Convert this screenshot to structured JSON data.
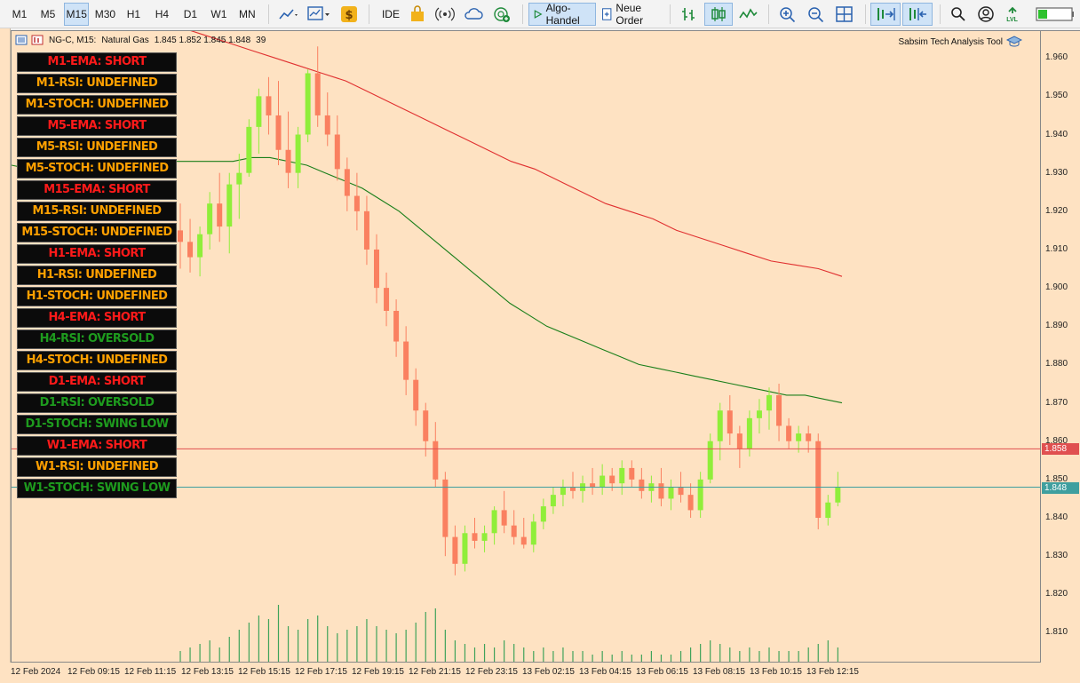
{
  "toolbar": {
    "timeframes": [
      "M1",
      "M5",
      "M15",
      "M30",
      "H1",
      "H4",
      "D1",
      "W1",
      "MN"
    ],
    "active_timeframe": "M15",
    "ide_label": "IDE",
    "algo_label": "Algo-Handel",
    "order_label": "Neue Order",
    "lvl_label": "LVL"
  },
  "chart": {
    "symbol": "NG-C, M15:",
    "description": "Natural Gas",
    "ohlc": "1.845 1.852 1.845 1.848",
    "extra": "39",
    "tool_label": "Sabsim Tech Analysis Tool"
  },
  "signals": [
    {
      "text": "M1-EMA: SHORT",
      "color": "#ff1a1a"
    },
    {
      "text": "M1-RSI: UNDEFINED",
      "color": "#ffa000"
    },
    {
      "text": "M1-STOCH: UNDEFINED",
      "color": "#ffa000"
    },
    {
      "text": "M5-EMA: SHORT",
      "color": "#ff1a1a"
    },
    {
      "text": "M5-RSI: UNDEFINED",
      "color": "#ffa000"
    },
    {
      "text": "M5-STOCH: UNDEFINED",
      "color": "#ffa000"
    },
    {
      "text": "M15-EMA: SHORT",
      "color": "#ff1a1a"
    },
    {
      "text": "M15-RSI: UNDEFINED",
      "color": "#ffa000"
    },
    {
      "text": "M15-STOCH: UNDEFINED",
      "color": "#ffa000"
    },
    {
      "text": "H1-EMA: SHORT",
      "color": "#ff1a1a"
    },
    {
      "text": "H1-RSI: UNDEFINED",
      "color": "#ffa000"
    },
    {
      "text": "H1-STOCH: UNDEFINED",
      "color": "#ffa000"
    },
    {
      "text": "H4-EMA: SHORT",
      "color": "#ff1a1a"
    },
    {
      "text": "H4-RSI: OVERSOLD",
      "color": "#1e9b1e"
    },
    {
      "text": "H4-STOCH: UNDEFINED",
      "color": "#ffa000"
    },
    {
      "text": "D1-EMA: SHORT",
      "color": "#ff1a1a"
    },
    {
      "text": "D1-RSI: OVERSOLD",
      "color": "#1e9b1e"
    },
    {
      "text": "D1-STOCH: SWING LOW",
      "color": "#1e9b1e"
    },
    {
      "text": "W1-EMA: SHORT",
      "color": "#ff1a1a"
    },
    {
      "text": "W1-RSI: UNDEFINED",
      "color": "#ffa000"
    },
    {
      "text": "W1-STOCH: SWING LOW",
      "color": "#1e9b1e"
    }
  ],
  "price_axis": [
    "1.960",
    "1.950",
    "1.940",
    "1.930",
    "1.920",
    "1.910",
    "1.900",
    "1.890",
    "1.880",
    "1.870",
    "1.860",
    "1.850",
    "1.840",
    "1.830",
    "1.820",
    "1.810"
  ],
  "price_labels": {
    "red_line": "1.858",
    "current": "1.848"
  },
  "time_axis": [
    "12 Feb 2024",
    "12 Feb 09:15",
    "12 Feb 11:15",
    "12 Feb 13:15",
    "12 Feb 15:15",
    "12 Feb 17:15",
    "12 Feb 19:15",
    "12 Feb 21:15",
    "12 Feb 23:15",
    "13 Feb 02:15",
    "13 Feb 04:15",
    "13 Feb 06:15",
    "13 Feb 08:15",
    "13 Feb 10:15",
    "13 Feb 12:15"
  ],
  "colors": {
    "bull": "#90ee3a",
    "bear": "#fa8060",
    "ema_fast": "#1a7f1a",
    "ema_slow": "#e03030",
    "chart_bg": "#fee2c2",
    "red_line": "#e05050",
    "current_line": "#3f9f9f"
  },
  "chart_data": {
    "type": "candlestick",
    "ylim": [
      1.802,
      1.967
    ],
    "candles": [
      {
        "o": 1.915,
        "h": 1.922,
        "l": 1.905,
        "c": 1.912
      },
      {
        "o": 1.912,
        "h": 1.918,
        "l": 1.904,
        "c": 1.908
      },
      {
        "o": 1.908,
        "h": 1.916,
        "l": 1.903,
        "c": 1.914
      },
      {
        "o": 1.914,
        "h": 1.925,
        "l": 1.91,
        "c": 1.922
      },
      {
        "o": 1.922,
        "h": 1.93,
        "l": 1.912,
        "c": 1.916
      },
      {
        "o": 1.916,
        "h": 1.93,
        "l": 1.909,
        "c": 1.927
      },
      {
        "o": 1.927,
        "h": 1.935,
        "l": 1.918,
        "c": 1.93
      },
      {
        "o": 1.93,
        "h": 1.944,
        "l": 1.929,
        "c": 1.942
      },
      {
        "o": 1.942,
        "h": 1.952,
        "l": 1.935,
        "c": 1.95
      },
      {
        "o": 1.95,
        "h": 1.955,
        "l": 1.94,
        "c": 1.945
      },
      {
        "o": 1.945,
        "h": 1.954,
        "l": 1.932,
        "c": 1.936
      },
      {
        "o": 1.936,
        "h": 1.946,
        "l": 1.926,
        "c": 1.93
      },
      {
        "o": 1.93,
        "h": 1.942,
        "l": 1.926,
        "c": 1.94
      },
      {
        "o": 1.94,
        "h": 1.957,
        "l": 1.938,
        "c": 1.956
      },
      {
        "o": 1.956,
        "h": 1.963,
        "l": 1.942,
        "c": 1.945
      },
      {
        "o": 1.945,
        "h": 1.951,
        "l": 1.937,
        "c": 1.94
      },
      {
        "o": 1.94,
        "h": 1.945,
        "l": 1.928,
        "c": 1.931
      },
      {
        "o": 1.931,
        "h": 1.934,
        "l": 1.92,
        "c": 1.924
      },
      {
        "o": 1.924,
        "h": 1.93,
        "l": 1.915,
        "c": 1.92
      },
      {
        "o": 1.92,
        "h": 1.924,
        "l": 1.906,
        "c": 1.91
      },
      {
        "o": 1.91,
        "h": 1.914,
        "l": 1.896,
        "c": 1.9
      },
      {
        "o": 1.9,
        "h": 1.904,
        "l": 1.89,
        "c": 1.894
      },
      {
        "o": 1.894,
        "h": 1.897,
        "l": 1.882,
        "c": 1.886
      },
      {
        "o": 1.886,
        "h": 1.89,
        "l": 1.872,
        "c": 1.876
      },
      {
        "o": 1.876,
        "h": 1.879,
        "l": 1.864,
        "c": 1.868
      },
      {
        "o": 1.868,
        "h": 1.87,
        "l": 1.856,
        "c": 1.86
      },
      {
        "o": 1.86,
        "h": 1.865,
        "l": 1.848,
        "c": 1.85
      },
      {
        "o": 1.85,
        "h": 1.852,
        "l": 1.83,
        "c": 1.835
      },
      {
        "o": 1.835,
        "h": 1.838,
        "l": 1.825,
        "c": 1.828
      },
      {
        "o": 1.828,
        "h": 1.838,
        "l": 1.826,
        "c": 1.836
      },
      {
        "o": 1.836,
        "h": 1.84,
        "l": 1.832,
        "c": 1.834
      },
      {
        "o": 1.834,
        "h": 1.838,
        "l": 1.831,
        "c": 1.836
      },
      {
        "o": 1.836,
        "h": 1.843,
        "l": 1.833,
        "c": 1.842
      },
      {
        "o": 1.842,
        "h": 1.847,
        "l": 1.836,
        "c": 1.838
      },
      {
        "o": 1.838,
        "h": 1.842,
        "l": 1.833,
        "c": 1.835
      },
      {
        "o": 1.835,
        "h": 1.84,
        "l": 1.832,
        "c": 1.833
      },
      {
        "o": 1.833,
        "h": 1.841,
        "l": 1.831,
        "c": 1.839
      },
      {
        "o": 1.839,
        "h": 1.845,
        "l": 1.837,
        "c": 1.843
      },
      {
        "o": 1.843,
        "h": 1.848,
        "l": 1.841,
        "c": 1.846
      },
      {
        "o": 1.846,
        "h": 1.85,
        "l": 1.843,
        "c": 1.848
      },
      {
        "o": 1.848,
        "h": 1.852,
        "l": 1.845,
        "c": 1.847
      },
      {
        "o": 1.847,
        "h": 1.851,
        "l": 1.844,
        "c": 1.849
      },
      {
        "o": 1.849,
        "h": 1.853,
        "l": 1.846,
        "c": 1.848
      },
      {
        "o": 1.848,
        "h": 1.854,
        "l": 1.846,
        "c": 1.851
      },
      {
        "o": 1.851,
        "h": 1.853,
        "l": 1.847,
        "c": 1.849
      },
      {
        "o": 1.849,
        "h": 1.855,
        "l": 1.846,
        "c": 1.853
      },
      {
        "o": 1.853,
        "h": 1.855,
        "l": 1.848,
        "c": 1.85
      },
      {
        "o": 1.85,
        "h": 1.853,
        "l": 1.845,
        "c": 1.847
      },
      {
        "o": 1.847,
        "h": 1.851,
        "l": 1.844,
        "c": 1.849
      },
      {
        "o": 1.849,
        "h": 1.853,
        "l": 1.843,
        "c": 1.845
      },
      {
        "o": 1.845,
        "h": 1.85,
        "l": 1.842,
        "c": 1.848
      },
      {
        "o": 1.848,
        "h": 1.852,
        "l": 1.844,
        "c": 1.846
      },
      {
        "o": 1.846,
        "h": 1.849,
        "l": 1.84,
        "c": 1.842
      },
      {
        "o": 1.842,
        "h": 1.852,
        "l": 1.84,
        "c": 1.85
      },
      {
        "o": 1.85,
        "h": 1.862,
        "l": 1.849,
        "c": 1.86
      },
      {
        "o": 1.86,
        "h": 1.87,
        "l": 1.855,
        "c": 1.868
      },
      {
        "o": 1.868,
        "h": 1.872,
        "l": 1.859,
        "c": 1.862
      },
      {
        "o": 1.862,
        "h": 1.864,
        "l": 1.853,
        "c": 1.858
      },
      {
        "o": 1.858,
        "h": 1.868,
        "l": 1.856,
        "c": 1.866
      },
      {
        "o": 1.866,
        "h": 1.871,
        "l": 1.862,
        "c": 1.868
      },
      {
        "o": 1.868,
        "h": 1.874,
        "l": 1.863,
        "c": 1.872
      },
      {
        "o": 1.872,
        "h": 1.875,
        "l": 1.86,
        "c": 1.864
      },
      {
        "o": 1.864,
        "h": 1.866,
        "l": 1.858,
        "c": 1.86
      },
      {
        "o": 1.86,
        "h": 1.864,
        "l": 1.857,
        "c": 1.862
      },
      {
        "o": 1.862,
        "h": 1.864,
        "l": 1.857,
        "c": 1.86
      },
      {
        "o": 1.86,
        "h": 1.862,
        "l": 1.837,
        "c": 1.84
      },
      {
        "o": 1.84,
        "h": 1.846,
        "l": 1.838,
        "c": 1.844
      },
      {
        "o": 1.844,
        "h": 1.852,
        "l": 1.843,
        "c": 1.848
      }
    ],
    "volume": [
      3,
      4,
      5,
      6,
      4,
      7,
      9,
      11,
      13,
      12,
      16,
      10,
      9,
      12,
      13,
      10,
      8,
      9,
      10,
      12,
      10,
      9,
      8,
      9,
      11,
      14,
      15,
      9,
      6,
      5,
      4,
      5,
      4,
      6,
      5,
      4,
      3,
      4,
      3,
      4,
      3,
      3,
      2,
      3,
      2,
      3,
      2,
      2,
      3,
      2,
      2,
      3,
      4,
      5,
      6,
      5,
      4,
      3,
      4,
      3,
      4,
      3,
      3,
      3,
      4,
      5,
      6,
      4
    ],
    "ema_fast": [
      1.932,
      1.931,
      1.931,
      1.931,
      1.931,
      1.931,
      1.931,
      1.932,
      1.933,
      1.933,
      1.933,
      1.933,
      1.933,
      1.934,
      1.934,
      1.933,
      1.932,
      1.93,
      1.928,
      1.926,
      1.923,
      1.92,
      1.916,
      1.912,
      1.908,
      1.904,
      1.9,
      1.896,
      1.893,
      1.89,
      1.888,
      1.886,
      1.884,
      1.882,
      1.88,
      1.879,
      1.878,
      1.877,
      1.876,
      1.875,
      1.874,
      1.873,
      1.872,
      1.872,
      1.871,
      1.87
    ],
    "ema_slow": [
      1.968,
      1.966,
      1.964,
      1.962,
      1.96,
      1.958,
      1.956,
      1.954,
      1.951,
      1.948,
      1.945,
      1.942,
      1.939,
      1.936,
      1.933,
      1.931,
      1.928,
      1.925,
      1.922,
      1.92,
      1.918,
      1.915,
      1.913,
      1.911,
      1.909,
      1.907,
      1.906,
      1.905,
      1.903
    ]
  }
}
